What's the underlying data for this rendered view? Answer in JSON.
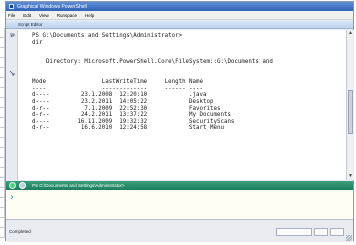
{
  "window": {
    "title": "Graphical Windows PowerShell"
  },
  "menu": {
    "items": [
      "File",
      "Edit",
      "View",
      "Runspace",
      "Help"
    ]
  },
  "script_pane": {
    "label": "Script Editor"
  },
  "console": {
    "lines": [
      "PS G:\\Documents and Settings\\Administrator>",
      "dir",
      "",
      "",
      "    Directory: Microsoft.PowerShell.Core\\FileSystem::G:\\Documents and",
      "",
      "",
      "Mode                LastWriteTime     Length Name",
      "----                -------------     ------ ----",
      "d----         23.1.2008  12:20:10            .java",
      "d----         23.2.2011  14:05:22            Desktop",
      "d-r--          7.1.2009  22:52:30            Favorites",
      "d-r--         24.2.2011  13:37:22            My Documents",
      "d----        16.11.2009  19:32:32            SecurityScans",
      "d-r--         16.6.2010  12:24:58            Start Menu"
    ]
  },
  "prompt_bar": {
    "path": "PS G:\\Documents and Settings\\Administrator>"
  },
  "status": {
    "text": "Completed"
  },
  "colors": {
    "title_bar": "#2f62b8",
    "prompt_bar": "#1f7d5d",
    "run_button": "#4fd27a"
  },
  "icons": [
    "app-icon",
    "run-icon",
    "stop-icon",
    "caret-prompt-icon",
    "resize-grip-icon"
  ]
}
